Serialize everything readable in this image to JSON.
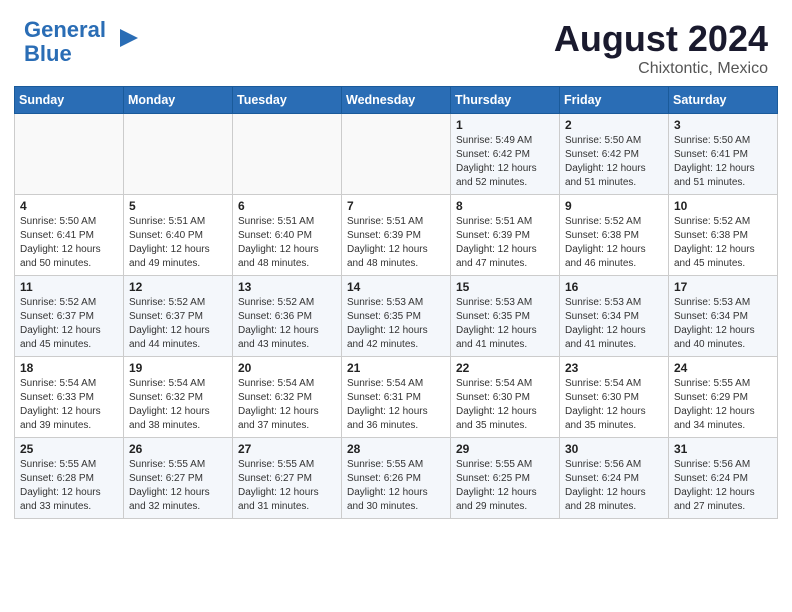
{
  "header": {
    "logo_line1": "General",
    "logo_line2": "Blue",
    "main_title": "August 2024",
    "subtitle": "Chixtontic, Mexico"
  },
  "calendar": {
    "days_of_week": [
      "Sunday",
      "Monday",
      "Tuesday",
      "Wednesday",
      "Thursday",
      "Friday",
      "Saturday"
    ],
    "weeks": [
      [
        {
          "day": "",
          "content": ""
        },
        {
          "day": "",
          "content": ""
        },
        {
          "day": "",
          "content": ""
        },
        {
          "day": "",
          "content": ""
        },
        {
          "day": "1",
          "content": "Sunrise: 5:49 AM\nSunset: 6:42 PM\nDaylight: 12 hours and 52 minutes."
        },
        {
          "day": "2",
          "content": "Sunrise: 5:50 AM\nSunset: 6:42 PM\nDaylight: 12 hours and 51 minutes."
        },
        {
          "day": "3",
          "content": "Sunrise: 5:50 AM\nSunset: 6:41 PM\nDaylight: 12 hours and 51 minutes."
        }
      ],
      [
        {
          "day": "4",
          "content": "Sunrise: 5:50 AM\nSunset: 6:41 PM\nDaylight: 12 hours and 50 minutes."
        },
        {
          "day": "5",
          "content": "Sunrise: 5:51 AM\nSunset: 6:40 PM\nDaylight: 12 hours and 49 minutes."
        },
        {
          "day": "6",
          "content": "Sunrise: 5:51 AM\nSunset: 6:40 PM\nDaylight: 12 hours and 48 minutes."
        },
        {
          "day": "7",
          "content": "Sunrise: 5:51 AM\nSunset: 6:39 PM\nDaylight: 12 hours and 48 minutes."
        },
        {
          "day": "8",
          "content": "Sunrise: 5:51 AM\nSunset: 6:39 PM\nDaylight: 12 hours and 47 minutes."
        },
        {
          "day": "9",
          "content": "Sunrise: 5:52 AM\nSunset: 6:38 PM\nDaylight: 12 hours and 46 minutes."
        },
        {
          "day": "10",
          "content": "Sunrise: 5:52 AM\nSunset: 6:38 PM\nDaylight: 12 hours and 45 minutes."
        }
      ],
      [
        {
          "day": "11",
          "content": "Sunrise: 5:52 AM\nSunset: 6:37 PM\nDaylight: 12 hours and 45 minutes."
        },
        {
          "day": "12",
          "content": "Sunrise: 5:52 AM\nSunset: 6:37 PM\nDaylight: 12 hours and 44 minutes."
        },
        {
          "day": "13",
          "content": "Sunrise: 5:52 AM\nSunset: 6:36 PM\nDaylight: 12 hours and 43 minutes."
        },
        {
          "day": "14",
          "content": "Sunrise: 5:53 AM\nSunset: 6:35 PM\nDaylight: 12 hours and 42 minutes."
        },
        {
          "day": "15",
          "content": "Sunrise: 5:53 AM\nSunset: 6:35 PM\nDaylight: 12 hours and 41 minutes."
        },
        {
          "day": "16",
          "content": "Sunrise: 5:53 AM\nSunset: 6:34 PM\nDaylight: 12 hours and 41 minutes."
        },
        {
          "day": "17",
          "content": "Sunrise: 5:53 AM\nSunset: 6:34 PM\nDaylight: 12 hours and 40 minutes."
        }
      ],
      [
        {
          "day": "18",
          "content": "Sunrise: 5:54 AM\nSunset: 6:33 PM\nDaylight: 12 hours and 39 minutes."
        },
        {
          "day": "19",
          "content": "Sunrise: 5:54 AM\nSunset: 6:32 PM\nDaylight: 12 hours and 38 minutes."
        },
        {
          "day": "20",
          "content": "Sunrise: 5:54 AM\nSunset: 6:32 PM\nDaylight: 12 hours and 37 minutes."
        },
        {
          "day": "21",
          "content": "Sunrise: 5:54 AM\nSunset: 6:31 PM\nDaylight: 12 hours and 36 minutes."
        },
        {
          "day": "22",
          "content": "Sunrise: 5:54 AM\nSunset: 6:30 PM\nDaylight: 12 hours and 35 minutes."
        },
        {
          "day": "23",
          "content": "Sunrise: 5:54 AM\nSunset: 6:30 PM\nDaylight: 12 hours and 35 minutes."
        },
        {
          "day": "24",
          "content": "Sunrise: 5:55 AM\nSunset: 6:29 PM\nDaylight: 12 hours and 34 minutes."
        }
      ],
      [
        {
          "day": "25",
          "content": "Sunrise: 5:55 AM\nSunset: 6:28 PM\nDaylight: 12 hours and 33 minutes."
        },
        {
          "day": "26",
          "content": "Sunrise: 5:55 AM\nSunset: 6:27 PM\nDaylight: 12 hours and 32 minutes."
        },
        {
          "day": "27",
          "content": "Sunrise: 5:55 AM\nSunset: 6:27 PM\nDaylight: 12 hours and 31 minutes."
        },
        {
          "day": "28",
          "content": "Sunrise: 5:55 AM\nSunset: 6:26 PM\nDaylight: 12 hours and 30 minutes."
        },
        {
          "day": "29",
          "content": "Sunrise: 5:55 AM\nSunset: 6:25 PM\nDaylight: 12 hours and 29 minutes."
        },
        {
          "day": "30",
          "content": "Sunrise: 5:56 AM\nSunset: 6:24 PM\nDaylight: 12 hours and 28 minutes."
        },
        {
          "day": "31",
          "content": "Sunrise: 5:56 AM\nSunset: 6:24 PM\nDaylight: 12 hours and 27 minutes."
        }
      ]
    ]
  }
}
